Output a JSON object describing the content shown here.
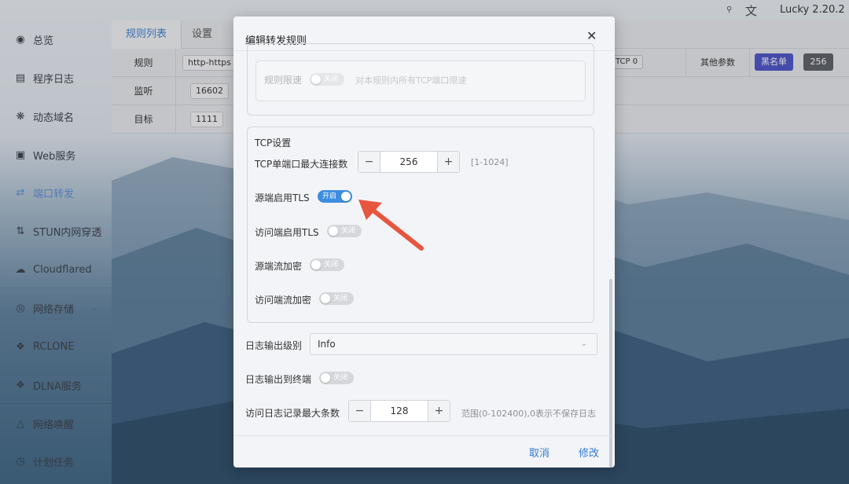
{
  "app": {
    "version": "Lucky 2.20.2"
  },
  "sidebar": {
    "items": [
      {
        "label": "总览",
        "icon": "dashboard-icon"
      },
      {
        "label": "程序日志",
        "icon": "log-icon"
      },
      {
        "label": "动态域名",
        "icon": "ddns-icon"
      },
      {
        "label": "Web服务",
        "icon": "web-icon"
      },
      {
        "label": "端口转发",
        "icon": "port-forward-icon"
      },
      {
        "label": "STUN内网穿透",
        "icon": "stun-icon"
      },
      {
        "label": "Cloudflared",
        "icon": "cloud-icon"
      },
      {
        "label": "网络存储",
        "icon": "storage-icon"
      },
      {
        "label": "RCLONE",
        "icon": "rclone-icon"
      },
      {
        "label": "DLNA服务",
        "icon": "dlna-icon"
      },
      {
        "label": "网络唤醒",
        "icon": "wake-icon"
      },
      {
        "label": "计划任务",
        "icon": "schedule-icon"
      }
    ]
  },
  "background": {
    "tabs": [
      "规则列表",
      "设置"
    ],
    "rows": [
      {
        "label": "规则",
        "value": "http-https"
      },
      {
        "label": "监听",
        "value": "16602"
      },
      {
        "label": "目标",
        "value": "1111"
      }
    ],
    "tcp_tag": "TCP",
    "tcp_count": "0",
    "other_params": "其他参数",
    "blacklist": "黑名单",
    "limit": "256"
  },
  "modal": {
    "title": "编辑转发规则",
    "rate_limit": {
      "label": "规则限速",
      "switch": "关闭",
      "hint": "对本规则内所有TCP端口限速"
    },
    "tcp_section": {
      "title": "TCP设置",
      "max_conn_label": "TCP单端口最大连接数",
      "max_conn_value": "256",
      "max_conn_range": "[1-1024]",
      "source_tls_label": "源端启用TLS",
      "source_tls_switch": "开启",
      "client_tls_label": "访问端启用TLS",
      "client_tls_switch": "关闭",
      "source_encrypt_label": "源端流加密",
      "source_encrypt_switch": "关闭",
      "client_encrypt_label": "访问端流加密",
      "client_encrypt_switch": "关闭"
    },
    "log_level_label": "日志输出级别",
    "log_level_value": "Info",
    "log_terminal_label": "日志输出到终端",
    "log_terminal_switch": "关闭",
    "access_log_label": "访问日志记录最大条数",
    "access_log_value": "128",
    "access_log_hint": "范围(0-102400),0表示不保存日志",
    "cancel": "取消",
    "submit": "修改"
  },
  "colors": {
    "accent": "#3d8de0",
    "arrow": "#e8553e"
  }
}
